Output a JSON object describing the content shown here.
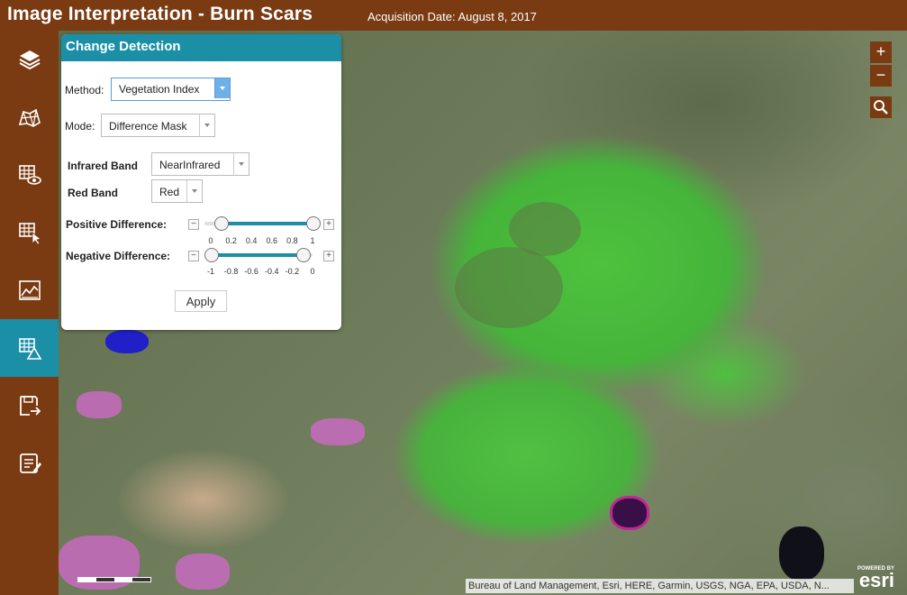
{
  "header": {
    "title": "Image Interpretation - Burn Scars",
    "acquisition_date": "Acquisition Date: August 8, 2017"
  },
  "sidebar": {
    "items": [
      {
        "name": "layers-icon"
      },
      {
        "name": "map-compare-icon"
      },
      {
        "name": "visual-grid-icon"
      },
      {
        "name": "grid-select-icon"
      },
      {
        "name": "image-chart-icon"
      },
      {
        "name": "change-detection-icon",
        "active": true
      },
      {
        "name": "export-icon"
      },
      {
        "name": "report-icon"
      }
    ]
  },
  "panel": {
    "title": "Change Detection",
    "method_label": "Method:",
    "method_value": "Vegetation Index",
    "mode_label": "Mode:",
    "mode_value": "Difference Mask",
    "infrared_label": "Infrared Band",
    "infrared_value": "NearInfrared",
    "red_label": "Red Band",
    "red_value": "Red",
    "positive_label": "Positive Difference:",
    "positive_ticks": [
      "0",
      "0.2",
      "0.4",
      "0.6",
      "0.8",
      "1"
    ],
    "positive_min_value": 0.1,
    "positive_max_value": 1.0,
    "negative_label": "Negative Difference:",
    "negative_ticks": [
      "-1",
      "-0.8",
      "-0.6",
      "-0.4",
      "-0.2",
      "0"
    ],
    "negative_min_value": -1.0,
    "negative_max_value": -0.1,
    "apply_label": "Apply"
  },
  "map": {
    "zoom_in": "+",
    "zoom_out": "−",
    "attribution": "Bureau of Land Management, Esri, HERE, Garmin, USGS, NGA, EPA, USDA, N...",
    "powered_by": "POWERED BY",
    "esri": "esri"
  }
}
